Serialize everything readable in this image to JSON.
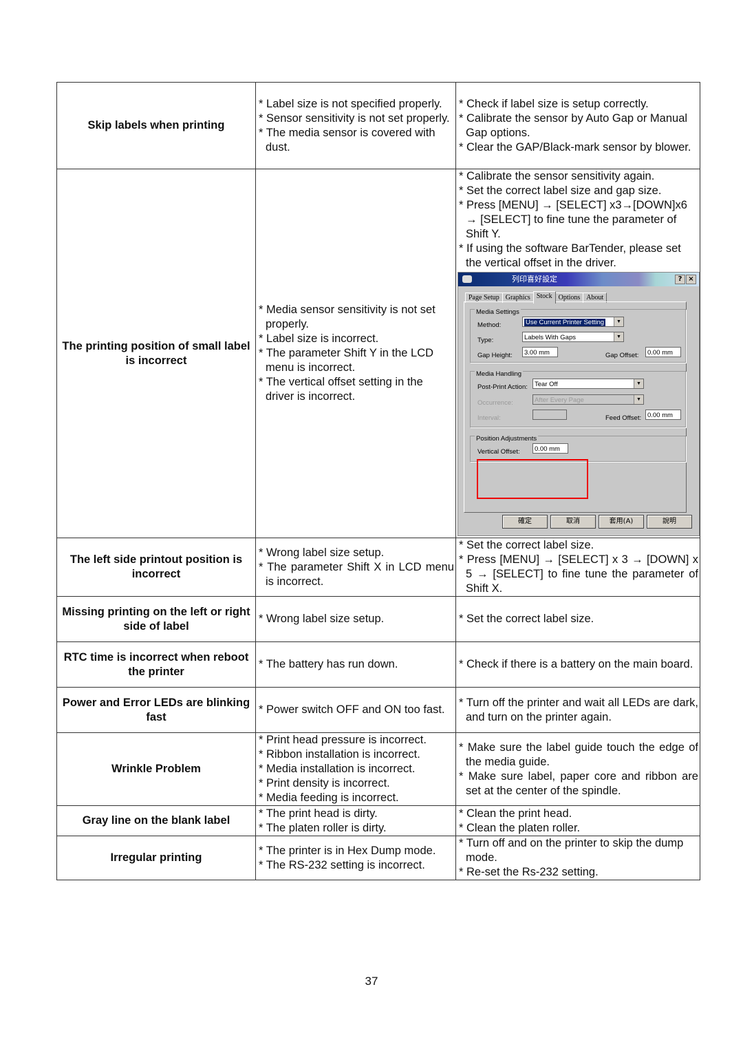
{
  "page_number": "37",
  "rows": [
    {
      "problem": "Skip labels when printing",
      "causes": [
        "Label size is not specified properly.",
        "Sensor sensitivity is not set properly.",
        "The media sensor is covered with dust."
      ],
      "solutions": [
        "Check if label size is setup correctly.",
        "Calibrate the sensor by Auto Gap or Manual Gap options.",
        "Clear the GAP/Black-mark sensor by blower."
      ]
    },
    {
      "problem": "The printing position of small label is incorrect",
      "causes": [
        "Media sensor sensitivity is not set properly.",
        "Label size is incorrect.",
        "The parameter Shift Y in the LCD menu is incorrect.",
        "The vertical offset setting in the driver is incorrect."
      ],
      "solutions": [
        "Calibrate the sensor sensitivity again.",
        "Set the correct label size and gap size.",
        "Press [MENU] → [SELECT] x3→[DOWN]x6 → [SELECT] to fine tune the parameter of Shift Y.",
        "If using the software BarTender, please set the vertical offset in the driver."
      ]
    },
    {
      "problem": "The left side printout position is incorrect",
      "causes": [
        "Wrong label size setup.",
        "The parameter Shift X in LCD menu is incorrect."
      ],
      "solutions": [
        "Set the correct label size.",
        "Press [MENU] → [SELECT] x 3 → [DOWN] x 5 → [SELECT] to fine tune the parameter of Shift X."
      ]
    },
    {
      "problem": "Missing printing on the left or right side of label",
      "causes": [
        "Wrong label size setup."
      ],
      "solutions": [
        "Set the correct label size."
      ]
    },
    {
      "problem": "RTC time is incorrect when reboot the printer",
      "causes": [
        "The battery has run down."
      ],
      "solutions": [
        "Check if there is a battery on the main board."
      ]
    },
    {
      "problem": "Power and Error LEDs are blinking fast",
      "causes": [
        "Power switch OFF and ON too fast."
      ],
      "solutions": [
        "Turn off the printer and wait all LEDs are dark, and turn on the printer again."
      ]
    },
    {
      "problem": "Wrinkle Problem",
      "causes": [
        "Print head pressure is incorrect.",
        "Ribbon installation is incorrect.",
        "Media installation is incorrect.",
        "Print density is incorrect.",
        "Media feeding is incorrect."
      ],
      "solutions": [
        "Make sure the label guide touch the edge of the media guide.",
        "Make sure label, paper core and ribbon are set at the center of the spindle."
      ]
    },
    {
      "problem": "Gray line on the blank label",
      "causes": [
        "The print head is dirty.",
        "The platen roller is dirty."
      ],
      "solutions": [
        "Clean the print head.",
        "Clean the platen roller."
      ]
    },
    {
      "problem": "Irregular printing",
      "causes": [
        "The printer is in Hex Dump mode.",
        "The RS-232 setting is incorrect."
      ],
      "solutions": [
        "Turn off and on the printer to skip the dump mode.",
        "Re-set the Rs-232 setting."
      ]
    }
  ],
  "dialog": {
    "title": "列印喜好設定",
    "help_btn": "?",
    "close_btn": "×",
    "tabs": [
      "Page Setup",
      "Graphics",
      "Stock",
      "Options",
      "About"
    ],
    "active_tab": "Stock",
    "media_settings": {
      "group": "Media Settings",
      "method_label": "Method:",
      "method_value": "Use Current Printer Setting",
      "type_label": "Type:",
      "type_value": "Labels With Gaps",
      "gap_height_label": "Gap Height:",
      "gap_height_value": "3.00 mm",
      "gap_offset_label": "Gap Offset:",
      "gap_offset_value": "0.00 mm"
    },
    "media_handling": {
      "group": "Media Handling",
      "post_print_label": "Post-Print Action:",
      "post_print_value": "Tear Off",
      "occurrence_label": "Occurrence:",
      "occurrence_value": "After Every Page",
      "interval_label": "Interval:",
      "interval_value": "",
      "feed_offset_label": "Feed Offset:",
      "feed_offset_value": "0.00 mm"
    },
    "position_adjustments": {
      "group": "Position Adjustments",
      "vertical_offset_label": "Vertical Offset:",
      "vertical_offset_value": "0.00 mm"
    },
    "highlight_color": "#e00000",
    "buttons": [
      "確定",
      "取消",
      "套用(A)",
      "說明"
    ]
  }
}
